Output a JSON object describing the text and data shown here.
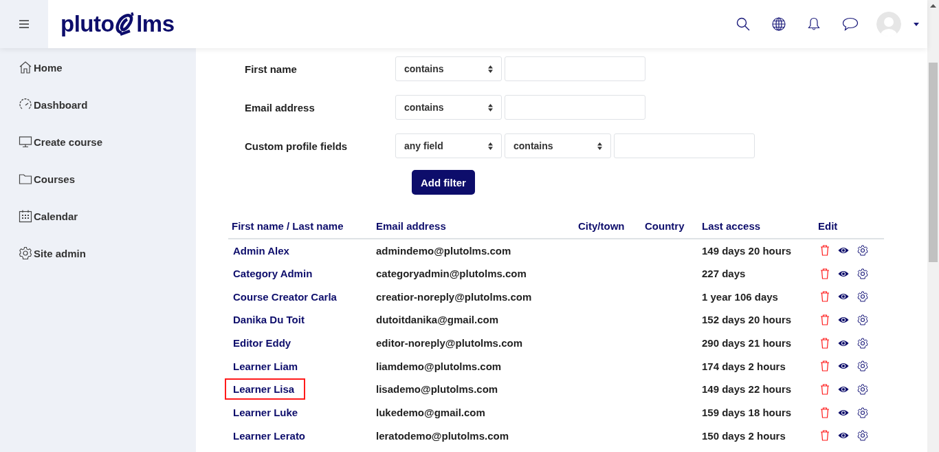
{
  "header": {
    "logo": {
      "left": "pluto",
      "right": "lms"
    }
  },
  "sidebar": {
    "items": [
      {
        "label": "Home",
        "kind": "home"
      },
      {
        "label": "Dashboard",
        "kind": "dashboard"
      },
      {
        "label": "Create course",
        "kind": "create"
      },
      {
        "label": "Courses",
        "kind": "courses"
      },
      {
        "label": "Calendar",
        "kind": "calendar"
      },
      {
        "label": "Site admin",
        "kind": "admin"
      }
    ]
  },
  "filters": [
    {
      "label": "First name",
      "controls": [
        {
          "kind": "select",
          "value": "contains"
        },
        {
          "kind": "input"
        }
      ]
    },
    {
      "label": "Email address",
      "controls": [
        {
          "kind": "select",
          "value": "contains"
        },
        {
          "kind": "input"
        }
      ]
    },
    {
      "label": "Custom profile fields",
      "controls": [
        {
          "kind": "select",
          "value": "any field"
        },
        {
          "kind": "select",
          "value": "contains"
        },
        {
          "kind": "input"
        }
      ]
    }
  ],
  "add_filter_button": "Add filter",
  "table": {
    "columns": [
      "First name / Last name",
      "Email address",
      "City/town",
      "Country",
      "Last access",
      "Edit"
    ],
    "rows": [
      {
        "name": "Admin Alex",
        "email": "admindemo@plutolms.com",
        "last_access": "149 days 20 hours",
        "highlighted": false
      },
      {
        "name": "Category Admin",
        "email": "categoryadmin@plutolms.com",
        "last_access": "227 days",
        "highlighted": false
      },
      {
        "name": "Course Creator Carla",
        "email": "creatior-noreply@plutolms.com",
        "last_access": "1 year 106 days",
        "highlighted": false
      },
      {
        "name": "Danika Du Toit",
        "email": "dutoitdanika@gmail.com",
        "last_access": "152 days 20 hours",
        "highlighted": false
      },
      {
        "name": "Editor Eddy",
        "email": "editor-noreply@plutolms.com",
        "last_access": "290 days 21 hours",
        "highlighted": false
      },
      {
        "name": "Learner Liam",
        "email": "liamdemo@plutolms.com",
        "last_access": "174 days 2 hours",
        "highlighted": false
      },
      {
        "name": "Learner Lisa",
        "email": "lisademo@plutolms.com",
        "last_access": "149 days 22 hours",
        "highlighted": true
      },
      {
        "name": "Learner Luke",
        "email": "lukedemo@gmail.com",
        "last_access": "159 days 18 hours",
        "highlighted": false
      },
      {
        "name": "Learner Lerato",
        "email": "leratodemo@plutolms.com",
        "last_access": "150 days 2 hours",
        "highlighted": false
      }
    ]
  }
}
